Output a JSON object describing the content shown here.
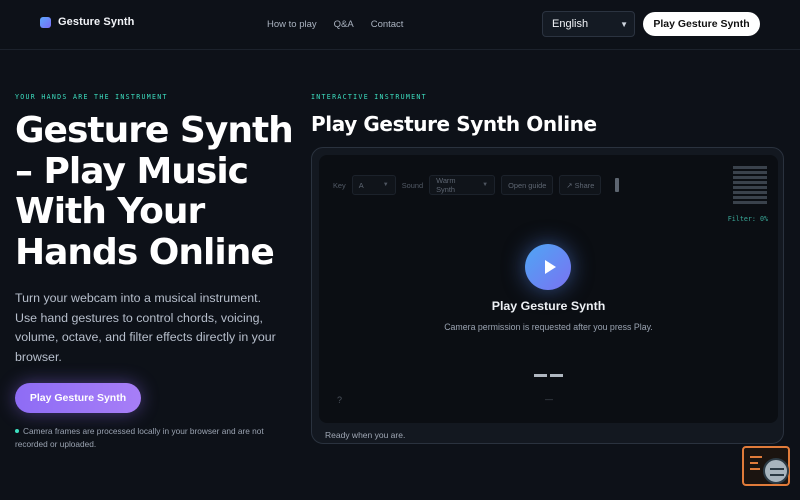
{
  "header": {
    "brand_name": "Gesture Synth",
    "nav": [
      "How to play",
      "Q&A",
      "Contact"
    ],
    "language_selected": "English",
    "cta_label": "Play Gesture Synth"
  },
  "hero": {
    "eyebrow": "YOUR HANDS ARE THE INSTRUMENT",
    "title": "Gesture Synth – Play Music With Your Hands Online",
    "description": "Turn your webcam into a musical instrument. Use hand gestures to control chords, voicing, volume, octave, and filter effects directly in your browser.",
    "cta_label": "Play Gesture Synth",
    "privacy_note": "Camera frames are processed locally in your browser and are not recorded or uploaded."
  },
  "instrument": {
    "eyebrow": "INTERACTIVE INSTRUMENT",
    "title": "Play Gesture Synth Online",
    "toolbar": {
      "key_label": "Key",
      "key_value": "A",
      "sound_label": "Sound",
      "sound_value": "Warm Synth",
      "guide_button": "Open guide",
      "share_button": "↗ Share"
    },
    "filter_readout": "Filter: 0%",
    "stage_title": "Play Gesture Synth",
    "stage_subtitle": "Camera permission is requested after you press Play.",
    "help_mark": "?",
    "small_dash": "—",
    "status": "Ready when you are."
  },
  "icons": {
    "brand": "gradient-square",
    "play": "play-triangle",
    "chevron": "chevron-down"
  },
  "colors": {
    "background": "#0d1118",
    "accent_teal": "#3ddfc0",
    "accent_purple": "#8e6cf5",
    "accent_blue": "#4ea6f4"
  }
}
